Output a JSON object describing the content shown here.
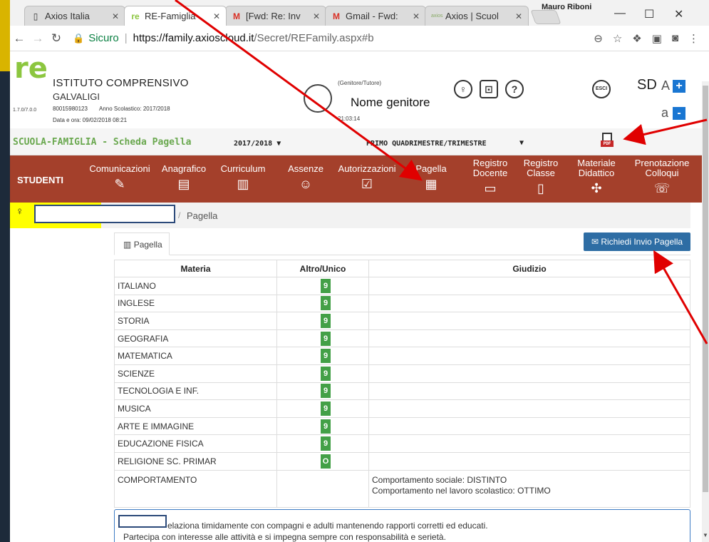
{
  "browser": {
    "user_name": "Mauro Riboni",
    "tabs": [
      {
        "label": "Axios Italia",
        "active": false
      },
      {
        "label": "RE-Famiglia",
        "active": true
      },
      {
        "label": "[Fwd: Re: Inv",
        "active": false
      },
      {
        "label": "Gmail - Fwd:",
        "active": false
      },
      {
        "label": "Axios | Scuol",
        "active": false
      }
    ],
    "secure_label": "Sicuro",
    "url_host": "https://family.axioscloud.it",
    "url_path": "/Secret/REFamily.aspx#b"
  },
  "header": {
    "version": "1.7.0/7.0.0",
    "school_name": "ISTITUTO COMPRENSIVO",
    "school_sub": "GALVALIGI",
    "school_code": "80015980123",
    "school_year": "Anno Scolastico: 2017/2018",
    "date_label": "Data e ora: 09/02/2018 08:21",
    "parent_role": "(Genitore/Tutore)",
    "parent_name": "Nome genitore",
    "parent_time": "21:03:14",
    "sd_logo": "SD",
    "font_increase": "+",
    "font_decrease": "-",
    "font_big": "A",
    "font_small": "a",
    "logout_label": "ESCI"
  },
  "subheader": {
    "title": "SCUOLA-FAMIGLIA - Scheda Pagella",
    "year": "2017/2018 ▼",
    "period": "PRIMO QUADRIMESTRE/TRIMESTRE",
    "caret": "▼",
    "pdf_label": "PDF"
  },
  "nav": {
    "students_label": "STUDENTI",
    "items": [
      {
        "label1": "Comunicazioni",
        "label2": "",
        "glyph": "✎"
      },
      {
        "label1": "Anagrafico",
        "label2": "",
        "glyph": "▤"
      },
      {
        "label1": "Curriculum",
        "label2": "",
        "glyph": "▥"
      },
      {
        "label1": "Assenze",
        "label2": "",
        "glyph": "☺"
      },
      {
        "label1": "Autorizzazioni",
        "label2": "",
        "glyph": "☑"
      },
      {
        "label1": "Pagella",
        "label2": "",
        "glyph": "▦"
      },
      {
        "label1": "Registro",
        "label2": "Docente",
        "glyph": "▭"
      },
      {
        "label1": "Registro",
        "label2": "Classe",
        "glyph": "▯"
      },
      {
        "label1": "Materiale",
        "label2": "Didattico",
        "glyph": "✣"
      },
      {
        "label1": "Prenotazione",
        "label2": "Colloqui",
        "glyph": "☏"
      }
    ]
  },
  "breadcrumb": {
    "symbol": "♀",
    "slash": "/",
    "current": "Pagella"
  },
  "content": {
    "tab_label": "Pagella",
    "tab_icon": "▥",
    "request_button": "Richiedi Invio Pagella",
    "request_icon": "✉"
  },
  "table": {
    "headers": [
      "Materia",
      "Altro/Unico",
      "Giudizio"
    ],
    "rows": [
      {
        "subject": "ITALIANO",
        "grade": "9"
      },
      {
        "subject": "INGLESE",
        "grade": "9"
      },
      {
        "subject": "STORIA",
        "grade": "9"
      },
      {
        "subject": "GEOGRAFIA",
        "grade": "9"
      },
      {
        "subject": "MATEMATICA",
        "grade": "9"
      },
      {
        "subject": "SCIENZE",
        "grade": "9"
      },
      {
        "subject": "TECNOLOGIA E INF.",
        "grade": "9"
      },
      {
        "subject": "MUSICA",
        "grade": "9"
      },
      {
        "subject": "ARTE E IMMAGINE",
        "grade": "9"
      },
      {
        "subject": "EDUCAZIONE FISICA",
        "grade": "9"
      },
      {
        "subject": "RELIGIONE SC. PRIMAR",
        "grade": "O"
      }
    ],
    "behaviour": {
      "subject": "COMPORTAMENTO",
      "line1": "Comportamento sociale: DISTINTO",
      "line2": "Comportamento nel lavoro scolastico: OTTIMO"
    }
  },
  "comment": {
    "line1": "elaziona timidamente con compagni e adulti mantenendo rapporti corretti ed educati.",
    "line2": "Partecipa con interesse alle attività e si impegna sempre con responsabilità e serietà."
  },
  "colors": {
    "nav_bg": "#a4402b",
    "grade_green": "#43a047",
    "button_blue": "#2e6da4",
    "title_green": "#6aa84f",
    "flag_yellow": "#ffff00",
    "arrow_red": "#e00000"
  }
}
